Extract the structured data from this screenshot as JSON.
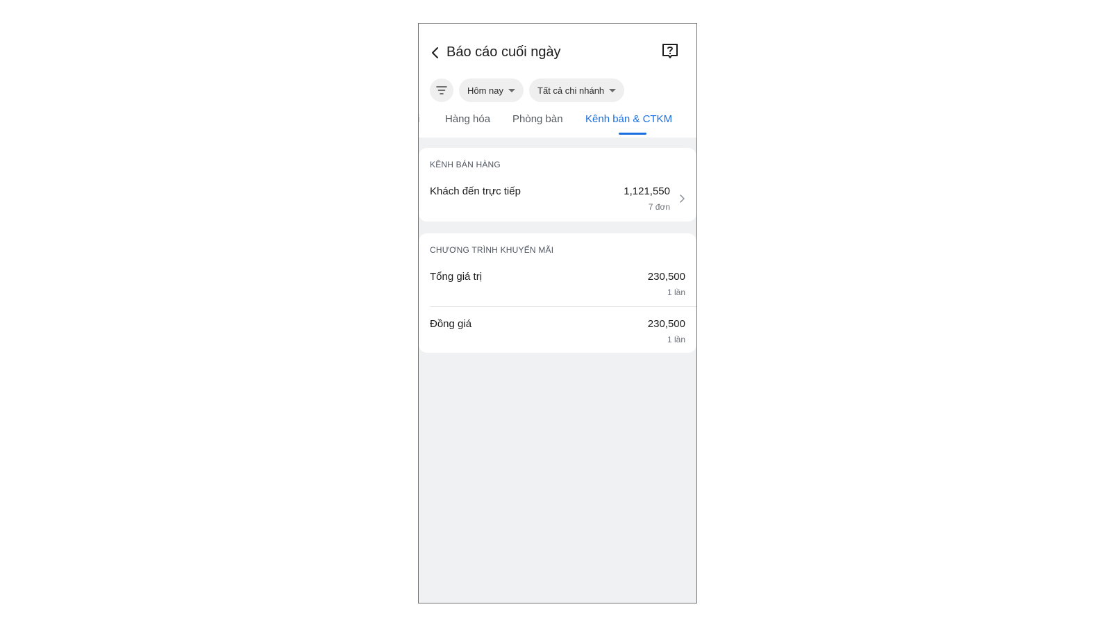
{
  "header": {
    "title": "Báo cáo cuối ngày"
  },
  "filters": {
    "date_label": "Hôm nay",
    "branch_label": "Tất cả chi nhánh"
  },
  "tabs": [
    {
      "label": "i"
    },
    {
      "label": "Hàng hóa"
    },
    {
      "label": "Phòng bàn"
    },
    {
      "label": "Kênh bán & CTKM",
      "active": true
    }
  ],
  "sales_channels": {
    "title": "KÊNH BÁN HÀNG",
    "items": [
      {
        "label": "Khách đến trực tiếp",
        "value": "1,121,550",
        "count": "7 đơn"
      }
    ]
  },
  "promotions": {
    "title": "CHƯƠNG TRÌNH KHUYẾN MÃI",
    "items": [
      {
        "label": "Tổng giá trị",
        "value": "230,500",
        "count": "1 lần"
      },
      {
        "label": "Đồng giá",
        "value": "230,500",
        "count": "1 lần"
      }
    ]
  },
  "colors": {
    "accent": "#1a6fe0",
    "background": "#f0f1f2",
    "card": "#ffffff"
  },
  "icons": {
    "back": "chevron-left-icon",
    "help": "help-chat-icon",
    "filter": "filter-icon",
    "dropdown": "caret-down-icon",
    "row_chevron": "chevron-right-icon"
  }
}
